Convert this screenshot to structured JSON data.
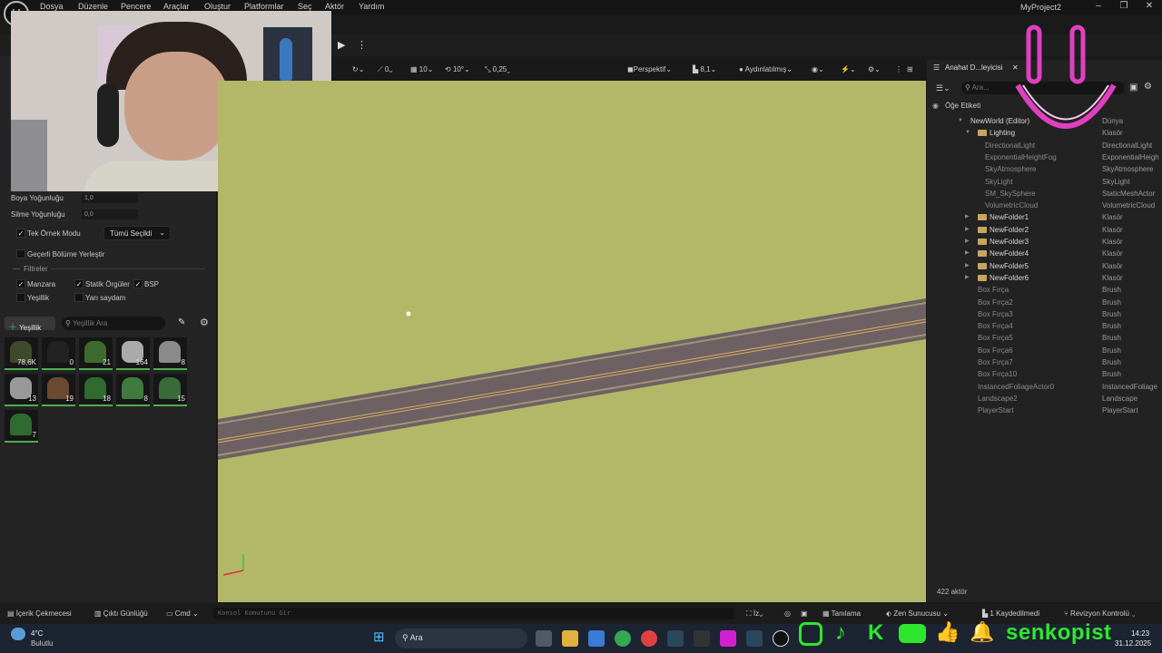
{
  "menu": [
    "Dosya",
    "Düzenle",
    "Pencere",
    "Araçlar",
    "Oluştur",
    "Platformlar",
    "Seç",
    "Aktör",
    "Yardım"
  ],
  "window": {
    "project": "MyProject2"
  },
  "viewport_toolbar": {
    "angle": "0",
    "grid": "10",
    "rot": "10°",
    "scale": "0,25",
    "perspective": "Perspektif",
    "speed": "8,1",
    "lit": "Aydınlatılmış"
  },
  "left": {
    "paint_density_label": "Boya Yoğunluğu",
    "paint_density": "1,0",
    "erase_density_label": "Silme Yoğunluğu",
    "erase_density": "0,0",
    "single_instance": "Tek Örnek Modu",
    "single_instance_value": "Tümü Seçildi",
    "place_current": "Geçerli Bölüme Yerleştir",
    "filters": "Filtreler",
    "f_landscape": "Manzara",
    "f_static": "Statik Örgüler",
    "f_bsp": "BSP",
    "f_foliage": "Yeşillik",
    "f_translucent": "Yarı saydam",
    "add_button": "Yeşillik",
    "search_placeholder": "Yeşillik Ara",
    "tiles": [
      "78,6K",
      "0",
      "21",
      "164",
      "8",
      "13",
      "19",
      "18",
      "8",
      "15",
      "7"
    ]
  },
  "outliner": {
    "tab": "Anahat D...leyicisi",
    "search_placeholder": "Ara...",
    "col_label": "Öğe Etiketi",
    "rows": [
      {
        "n": "NewWorld (Editor)",
        "t": "Dünya"
      },
      {
        "n": "Lighting",
        "t": "Klasör"
      },
      {
        "n": "DirectionalLight",
        "t": "DirectionalLight"
      },
      {
        "n": "ExponentialHeightFog",
        "t": "ExponentialHeigh"
      },
      {
        "n": "SkyAtmosphere",
        "t": "SkyAtmosphere"
      },
      {
        "n": "SkyLight",
        "t": "SkyLight"
      },
      {
        "n": "SM_SkySphere",
        "t": "StaticMeshActor"
      },
      {
        "n": "VolumetricCloud",
        "t": "VolumetricCloud"
      },
      {
        "n": "NewFolder1",
        "t": "Klasör"
      },
      {
        "n": "NewFolder2",
        "t": "Klasör"
      },
      {
        "n": "NewFolder3",
        "t": "Klasör"
      },
      {
        "n": "NewFolder4",
        "t": "Klasör"
      },
      {
        "n": "NewFolder5",
        "t": "Klasör"
      },
      {
        "n": "NewFolder6",
        "t": "Klasör"
      },
      {
        "n": "Box Fırça",
        "t": "Brush"
      },
      {
        "n": "Box Fırça2",
        "t": "Brush"
      },
      {
        "n": "Box Fırça3",
        "t": "Brush"
      },
      {
        "n": "Box Fırça4",
        "t": "Brush"
      },
      {
        "n": "Box Fırça5",
        "t": "Brush"
      },
      {
        "n": "Box Fırça6",
        "t": "Brush"
      },
      {
        "n": "Box Fırça7",
        "t": "Brush"
      },
      {
        "n": "Box Fırça10",
        "t": "Brush"
      },
      {
        "n": "InstancedFoliageActor0",
        "t": "InstancedFoliage"
      },
      {
        "n": "Landscape2",
        "t": "Landscape"
      },
      {
        "n": "PlayerStart",
        "t": "PlayerStart"
      }
    ],
    "count": "422 aktör"
  },
  "bottom": {
    "content": "İçerik Çekmecesi",
    "output": "Çıktı Günlüğü",
    "cmd": "Cmd",
    "console_placeholder": "Konsol Komutunu Gir",
    "iz": "İz",
    "diag": "Tanılama",
    "zen": "Zen Sunucusu",
    "saved": "1 Kaydedilmedi",
    "rev": "Revizyon Kontrolü"
  },
  "taskbar": {
    "temp": "4°C",
    "weather": "Bulutlu",
    "search": "Ara",
    "time": "14:23",
    "date": "31.12.2025"
  },
  "overlay": {
    "brand": "senkopist"
  },
  "colors": {
    "bg": "#1a1a1a",
    "panel": "#242424",
    "grass": "#b3b868",
    "road": "#6e6163",
    "accent": "#4caf50",
    "pink": "#e040c0"
  }
}
